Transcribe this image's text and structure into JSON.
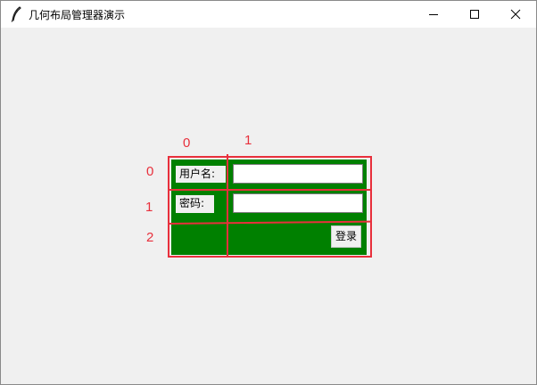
{
  "window": {
    "title": "几何布局管理器演示",
    "controls": {
      "minimize_icon": "minimize-icon",
      "maximize_icon": "maximize-icon",
      "close_icon": "close-icon"
    }
  },
  "grid_annotations": {
    "columns": [
      "0",
      "1"
    ],
    "rows": [
      "0",
      "1",
      "2"
    ],
    "line_color": "#e8303c"
  },
  "form": {
    "background_color": "#008000",
    "username_label": "用户名:",
    "username_value": "",
    "password_label": "密码:",
    "password_value": "",
    "login_button": "登录"
  }
}
